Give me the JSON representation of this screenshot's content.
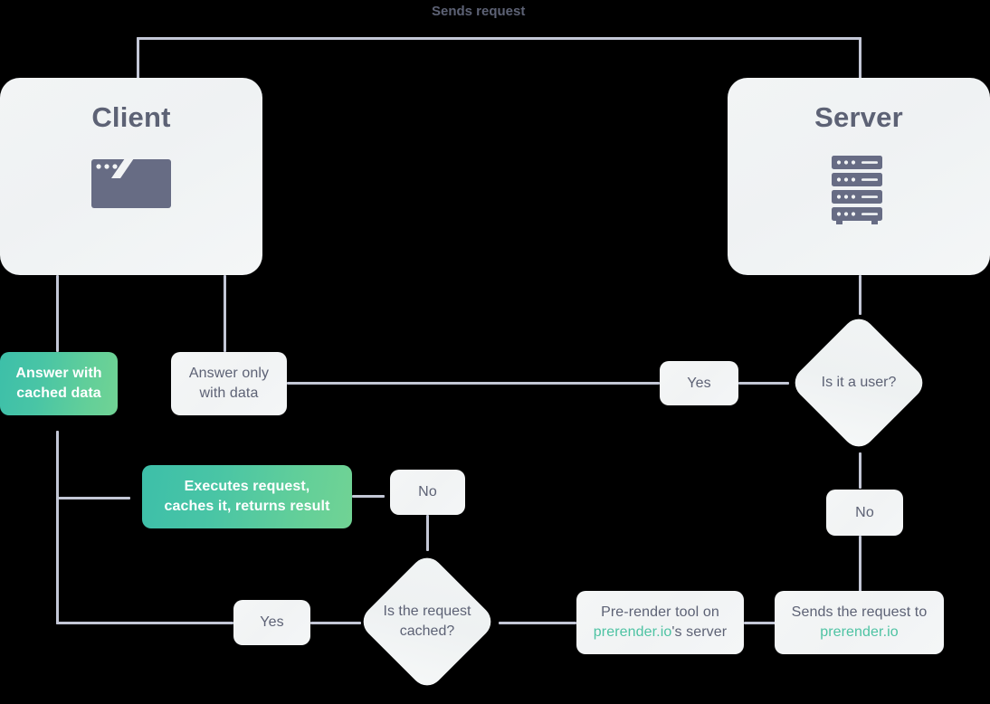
{
  "diagram": {
    "title_label": "Sends request",
    "accent_color": "#4ec3a3",
    "line_color": "#c3c7d6",
    "text_color": "#5d6275",
    "panels": [
      {
        "id": "client",
        "title": "Client",
        "icon": "browser-window-icon"
      },
      {
        "id": "server",
        "title": "Server",
        "icon": "server-rack-icon"
      }
    ],
    "nodes": {
      "answer_cached": {
        "line1": "Answer with",
        "line2": "cached data",
        "style": "green"
      },
      "answer_only": {
        "line1": "Answer only",
        "line2": "with data",
        "style": "plain"
      },
      "executes": {
        "line1": "Executes request,",
        "line2": "caches it, returns result",
        "style": "green"
      },
      "yes_top": {
        "label": "Yes"
      },
      "no_mid": {
        "label": "No"
      },
      "no_right": {
        "label": "No"
      },
      "yes_bottom": {
        "label": "Yes"
      },
      "prerender_tool": {
        "line1": "Pre-render tool on",
        "line2_link": "prerender.io",
        "line2_rest": "'s server"
      },
      "sends_request_to": {
        "line1": "Sends the request to",
        "line2_link": "prerender.io"
      }
    },
    "decisions": {
      "is_user": {
        "label": "Is it a user?"
      },
      "is_cached": {
        "line1": "Is the request",
        "line2": "cached?"
      }
    }
  }
}
